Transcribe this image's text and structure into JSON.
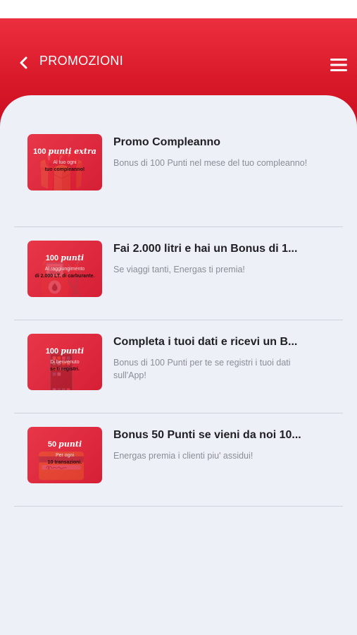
{
  "header": {
    "title": "PROMOZIONI",
    "back_icon": "chevron-left-icon",
    "menu_icon": "hamburger-menu-icon",
    "color": "#e02233"
  },
  "promotions": [
    {
      "title": "Promo Compleanno",
      "description": "Bonus di 100 Punti nel mese del tuo compleanno!",
      "thumb": {
        "headline": "100",
        "script": "punti extra",
        "line2": "Al tuo ogni",
        "line3": "tuo compleanno!"
      }
    },
    {
      "title": "Fai 2.000 litri e hai un Bonus di 1...",
      "description": "Se viaggi tanti, Energas ti premia!",
      "thumb": {
        "headline": "100",
        "script": "punti",
        "line2": "Al raggiungimento",
        "line3": "di 2.000 LT. di carburante."
      }
    },
    {
      "title": "Completa i tuoi dati e ricevi un B...",
      "description": "Bonus di 100 Punti per te se registri i tuoi dati sull'App!",
      "thumb": {
        "headline": "100",
        "script": "punti",
        "line2": "Di benvenuto",
        "line3": "se ti registri."
      }
    },
    {
      "title": "Bonus 50 Punti se vieni da noi 10...",
      "description": "Energas premia i clienti piu' assidui!",
      "thumb": {
        "headline": "50",
        "script": "punti",
        "line2": "Per ogni",
        "line3": "10 transazioni."
      }
    }
  ]
}
